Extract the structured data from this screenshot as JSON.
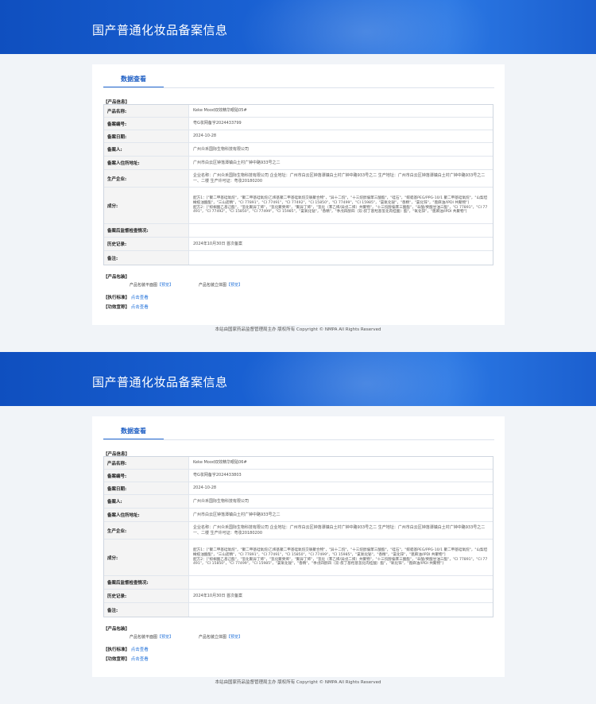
{
  "screens": [
    {
      "header_title": "国产普通化妆品备案信息",
      "tab_label": "数据查看",
      "section_product_info": "【产品信息】",
      "rows": [
        {
          "label": "产品名称:",
          "value": "Keke Mood双效精华眼贴05#"
        },
        {
          "label": "备案编号:",
          "value": "粤G妆网备字2024433799"
        },
        {
          "label": "备案日期:",
          "value": "2024-10-28"
        },
        {
          "label": "备案人:",
          "value": "广州众禾国际生物科技有限公司"
        },
        {
          "label": "备案人住所地址:",
          "value": "广州市白云区钟落潭镇白土村广钟中路933号之二"
        },
        {
          "label": "生产企业:",
          "value": "企业名称：广州众禾国际生物科技有限公司 企业地址：广州市白云区钟落潭镇白土村广钟中路933号之二 生产地址：广州市白云区钟落潭镇白土村广钟中路933号之二一、二楼 生产许可证：粤妆20180200"
        },
        {
          "label": "成分:",
          "value": "配方1：[\"聚二甲基硅氧烷\"，\"聚二甲基硅氧烷/乙烯基聚二甲基硅氧烷交联聚合物\"，\"异十二烷\"，\"十三烷醇偏苯三酸酯\"，\"硅石\"，\"鲸蜡基PEG/PPG-10/1 聚二甲基硅氧烷\"，\"山梨坦橄榄油酸酯\"，\"三山嵛精\"，\"CI 77891\"，\"CI 77491\"，\"CI 77492\"，\"CI 15850\"，\"CI 77499\"，\"CI 15985\"，\"氯氧化铋\"，\"香精\"，\"氯化锌\"，\"蓖麻油/IPDI 共聚物\"]\n配方2：[\"棕榈酸乙基己酯\"，\"氢化聚异丁烯\"，\"氢化聚癸烯\"，\"聚异丁烯\"，\"氢化（苯乙烯/异戊二烯）共聚物\"，\"十三烷醇偏苯三酸酯\"，\"辛酸/癸酸甘油三酯\"，\"CI 77891\"，\"CI 77491\"，\"CI 77492\"，\"CI 15850\"，\"CI 77499\"，\"CI 15985\"，\"氯氧化铋\"，\"香精\"，\"季戊四醇四（双-叔丁基羟基氢化肉桂酸）酯\"，\"氧化锌\"，\"蓖麻油/IPDI 共聚物\"]"
        },
        {
          "label": "备案后监督检查情况:",
          "value": ""
        },
        {
          "label": "历史记录:",
          "value": "2024年10月30日 首次备案"
        },
        {
          "label": "备注:",
          "value": ""
        }
      ],
      "section_packaging": "【产品包装】",
      "pkg_flat_label": "产品包装平面图",
      "pkg_3d_label": "产品包装立体图",
      "preview_link": "【预览】",
      "standard_label": "【执行标准】",
      "efficacy_label": "【功效宣称】",
      "view_link": "点击查看",
      "footer": "本站由国家药品监督管理局主办 版权所有 Copyright © NMPA All Rights Reserved"
    },
    {
      "header_title": "国产普通化妆品备案信息",
      "tab_label": "数据查看",
      "section_product_info": "【产品信息】",
      "rows": [
        {
          "label": "产品名称:",
          "value": "Keke Mood双效精华眼贴06#"
        },
        {
          "label": "备案编号:",
          "value": "粤G妆网备字2024433803"
        },
        {
          "label": "备案日期:",
          "value": "2024-10-28"
        },
        {
          "label": "备案人:",
          "value": "广州众禾国际生物科技有限公司"
        },
        {
          "label": "备案人住所地址:",
          "value": "广州市白云区钟落潭镇白土村广钟中路933号之二"
        },
        {
          "label": "生产企业:",
          "value": "企业名称：广州众禾国际生物科技有限公司 企业地址：广州市白云区钟落潭镇白土村广钟中路933号之二 生产地址：广州市白云区钟落潭镇白土村广钟中路933号之二一、二楼 生产许可证：粤妆20180200"
        },
        {
          "label": "成分:",
          "value": "配方1：[\"聚二甲基硅氧烷\"，\"聚二甲基硅氧烷/乙烯基聚二甲基硅氧烷交联聚合物\"，\"异十二烷\"，\"十三烷醇偏苯三酸酯\"，\"硅石\"，\"鲸蜡基PEG/PPG-10/1 聚二甲基硅氧烷\"，\"山梨坦橄榄油酸酯\"，\"三山嵛精\"，\"CI 77891\"，\"CI 77491\"，\"CI 15850\"，\"CI 77499\"，\"CI 15985\"，\"氯氧化铋\"，\"香精\"，\"氯化锌\"，\"蓖麻油/IPDI 共聚物\"]\n配方2：[\"棕榈酸乙基己酯\"，\"氢化聚异丁烯\"，\"氢化聚癸烯\"，\"聚异丁烯\"，\"氢化（苯乙烯/异戊二烯）共聚物\"，\"十三烷醇偏苯三酸酯\"，\"辛酸/癸酸甘油三酯\"，\"CI 77891\"，\"CI 77491\"，\"CI 15850\"，\"CI 77499\"，\"CI 15985\"，\"氯氧化铋\"，\"香精\"，\"季戊四醇四（双-叔丁基羟基氢化肉桂酸）酯\"，\"氧化锌\"，\"蓖麻油/IPDI 共聚物\"]"
        },
        {
          "label": "备案后监督检查情况:",
          "value": ""
        },
        {
          "label": "历史记录:",
          "value": "2024年10月30日 首次备案"
        },
        {
          "label": "备注:",
          "value": ""
        }
      ],
      "section_packaging": "【产品包装】",
      "pkg_flat_label": "产品包装平面图",
      "pkg_3d_label": "产品包装立体图",
      "preview_link": "【预览】",
      "standard_label": "【执行标准】",
      "efficacy_label": "【功效宣称】",
      "view_link": "点击查看",
      "footer": "本站由国家药品监督管理局主办 版权所有 Copyright © NMPA All Rights Reserved"
    }
  ]
}
